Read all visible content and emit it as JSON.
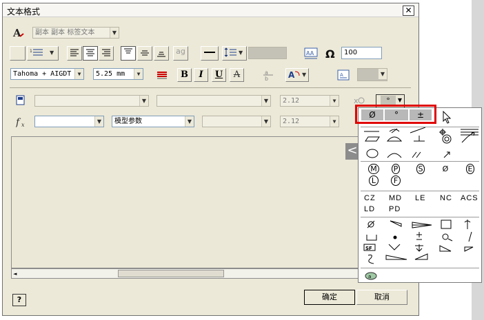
{
  "window": {
    "title": "文本格式",
    "close_glyph": "✕"
  },
  "toolbar": {
    "style_select": {
      "value": "副本 副本 标签文本"
    },
    "width_value": "100",
    "font_select": {
      "value": "Tahoma + AIGDT"
    },
    "size_select": {
      "value": "5.25 mm"
    },
    "bold_label": "B",
    "italic_label": "I",
    "underline_label": "U",
    "strike_label": "A",
    "ag_label": "ag"
  },
  "params": {
    "precision1": "2.12",
    "precision2": "2.12",
    "param_type": "模型参数",
    "fx_label": "fx",
    "symbol_button": "°"
  },
  "symbols_popup": {
    "top_row": [
      "Ø",
      "°",
      "±"
    ],
    "codes_row1": [
      "CZ",
      "MD",
      "LE",
      "NC",
      "ACS"
    ],
    "codes_row2": [
      "LD",
      "PD"
    ],
    "circled": [
      "M",
      "P",
      "S",
      "Ø",
      "E",
      "L",
      "F"
    ]
  },
  "footer": {
    "ok_label": "确定",
    "cancel_label": "取消",
    "help_label": "?"
  },
  "colors": {
    "dialog_bg": "#ece9d8",
    "highlight_red": "#e00000",
    "textarea_bg": "#ebe8d7"
  }
}
